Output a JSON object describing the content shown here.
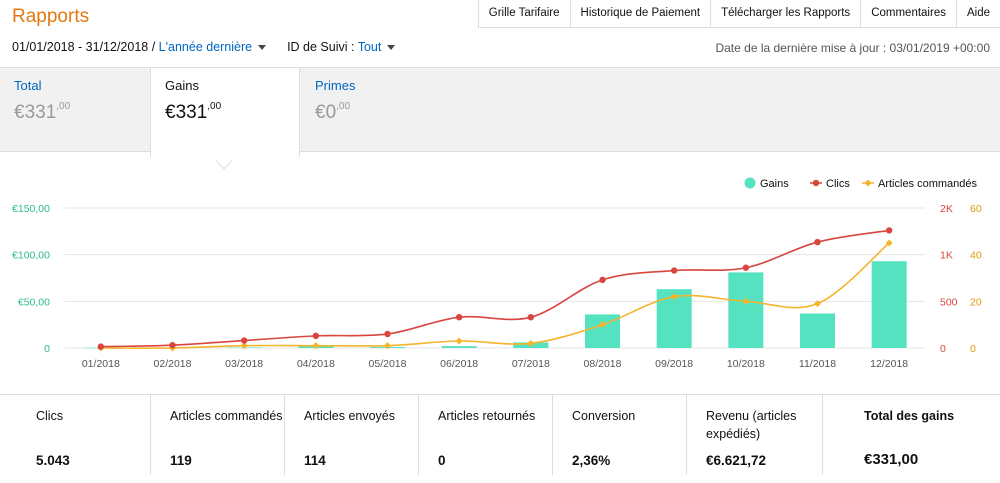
{
  "header": {
    "title": "Rapports",
    "nav": [
      "Grille Tarifaire",
      "Historique de Paiement",
      "Télécharger les Rapports",
      "Commentaires",
      "Aide"
    ]
  },
  "filters": {
    "date_range": "01/01/2018 - 31/12/2018 /",
    "period_link": "L'année dernière",
    "tracking_label": "ID de Suivi :",
    "tracking_value": "Tout",
    "last_update": "Date de la dernière mise à jour : 03/01/2019 +00:00"
  },
  "tabs": [
    {
      "label": "Total",
      "currency": "€",
      "whole": "331",
      "cents": ",00"
    },
    {
      "label": "Gains",
      "currency": "€",
      "whole": "331",
      "cents": ",00"
    },
    {
      "label": "Primes",
      "currency": "€",
      "whole": "0",
      "cents": ",00"
    }
  ],
  "colors": {
    "gains": "#55e2c1",
    "clics": "#d9453f",
    "articles": "#f4b42c",
    "accent": "#e47911",
    "link": "#0066c0"
  },
  "chart_data": {
    "type": "bar",
    "categories": [
      "01/2018",
      "02/2018",
      "03/2018",
      "04/2018",
      "05/2018",
      "06/2018",
      "07/2018",
      "08/2018",
      "09/2018",
      "10/2018",
      "11/2018",
      "12/2018"
    ],
    "series": [
      {
        "name": "Gains",
        "type": "bar",
        "axis": "left",
        "values": [
          0.2,
          0.3,
          0.5,
          3,
          1,
          2,
          6,
          36,
          63,
          81,
          37,
          93
        ]
      },
      {
        "name": "Clics",
        "type": "line",
        "axis": "right1",
        "values": [
          15,
          30,
          80,
          130,
          150,
          330,
          330,
          730,
          830,
          860,
          1270,
          1520
        ]
      },
      {
        "name": "Articles commandés",
        "type": "line",
        "axis": "right2",
        "values": [
          0,
          0,
          1,
          1,
          1,
          3,
          2,
          10,
          22,
          20,
          19,
          45
        ]
      }
    ],
    "left_axis": {
      "ticks": [
        "0",
        "€50,00",
        "€100,00",
        "€150,00"
      ],
      "range": [
        0,
        150
      ]
    },
    "right_axis_1": {
      "ticks": [
        "0",
        "500",
        "1K",
        "2K"
      ],
      "range": [
        0,
        2000
      ]
    },
    "right_axis_2": {
      "ticks": [
        "0",
        "20",
        "40",
        "60"
      ],
      "range": [
        0,
        60
      ]
    },
    "legend": [
      "Gains",
      "Clics",
      "Articles commandés"
    ],
    "legend_position": "top-right",
    "grid": true
  },
  "stats": [
    {
      "label": "Clics",
      "value": "5.043"
    },
    {
      "label": "Articles commandés",
      "value": "119"
    },
    {
      "label": "Articles envoyés",
      "value": "114"
    },
    {
      "label": "Articles retournés",
      "value": "0"
    },
    {
      "label": "Conversion",
      "value": "2,36%"
    },
    {
      "label": "Revenu (articles expédiés)",
      "value": "€6.621,72"
    },
    {
      "label": "Total des gains",
      "value": "€331,00"
    }
  ]
}
